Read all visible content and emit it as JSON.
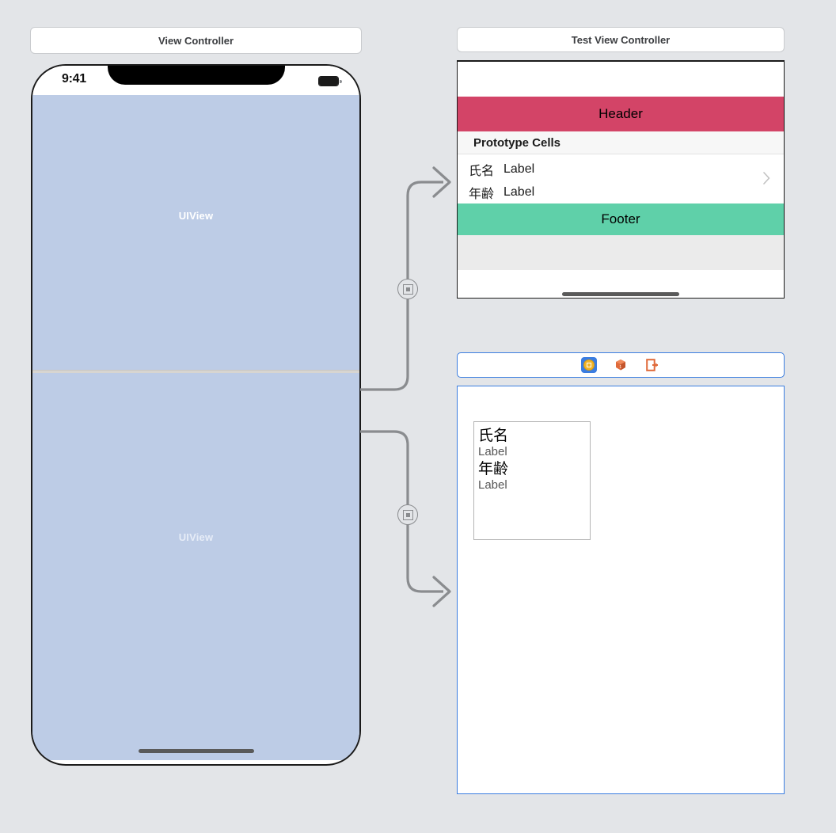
{
  "canvas": {
    "background_color": "#e3e5e8",
    "accent_selection_color": "#3b7de0"
  },
  "scenes": [
    {
      "id": "view-controller",
      "title": "View Controller",
      "device": {
        "status_bar": {
          "time": "9:41",
          "battery_icon": "battery-full-icon"
        },
        "home_indicator": true,
        "subviews": [
          {
            "name": "UIView",
            "label": "UIView",
            "color": "#bdcce6"
          },
          {
            "name": "UIView",
            "label": "UIView",
            "color": "#bdcce6"
          }
        ]
      }
    },
    {
      "id": "test-view-controller",
      "title": "Test View Controller",
      "table": {
        "header": {
          "label": "Header",
          "color": "#d34467"
        },
        "prototype_section_label": "Prototype Cells",
        "cell": {
          "rows": [
            {
              "key": "氏名",
              "value": "Label"
            },
            {
              "key": "年齢",
              "value": "Label"
            }
          ],
          "accessory": "chevron-right-icon"
        },
        "footer": {
          "label": "Footer",
          "color": "#5fd0a9"
        },
        "home_indicator": true
      }
    }
  ],
  "scene_dock": {
    "items": [
      {
        "name": "view-controller",
        "icon": "view-controller-icon",
        "selected": true
      },
      {
        "name": "first-responder",
        "icon": "first-responder-cube-icon",
        "selected": false
      },
      {
        "name": "exit",
        "icon": "exit-icon",
        "selected": false
      }
    ]
  },
  "cell_canvas": {
    "cell": {
      "lines": [
        {
          "text": "氏名",
          "style": "key"
        },
        {
          "text": "Label",
          "style": "val"
        },
        {
          "text": "年齢",
          "style": "key"
        },
        {
          "text": "Label",
          "style": "val"
        }
      ]
    }
  },
  "segues": [
    {
      "id": "segue-1",
      "badge_icon": "segue-show-icon",
      "from": "view-controller",
      "to": "test-view-controller"
    },
    {
      "id": "segue-2",
      "badge_icon": "segue-show-icon",
      "from": "view-controller",
      "to": "cell-canvas"
    }
  ]
}
